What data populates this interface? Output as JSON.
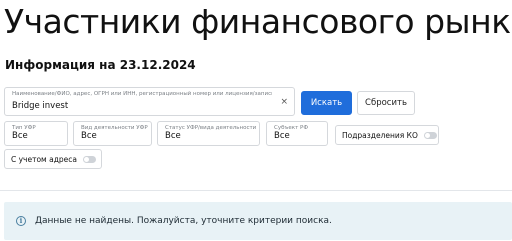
{
  "header": {
    "title": "Участники финансового рынка",
    "info_date": "Информация на 23.12.2024"
  },
  "search": {
    "label": "Наименование/ФИО, адрес, ОГРН или ИНН, регистрационный номер или лицензия/записи...",
    "value": "Bridge invest",
    "clear_icon": "×",
    "search_button": "Искать",
    "reset_button": "Сбросить"
  },
  "filters": [
    {
      "label": "Тип УФР",
      "value": "Все"
    },
    {
      "label": "Вид деятельности УФР",
      "value": "Все"
    },
    {
      "label": "Статус УФР/вида деятельности",
      "value": "Все"
    },
    {
      "label": "Субъект РФ",
      "value": "Все"
    }
  ],
  "toggles": {
    "ko_subdivisions": {
      "label": "Подразделения КО",
      "on": false
    },
    "with_address": {
      "label": "С учетом адреса",
      "on": false
    }
  },
  "alert": {
    "icon": "i",
    "text": "Данные не найдены. Пожалуйста, уточните критерии поиска.",
    "background": "#e8f2f6"
  },
  "colors": {
    "primary": "#1f6ddb",
    "border": "#d5d8dc"
  }
}
